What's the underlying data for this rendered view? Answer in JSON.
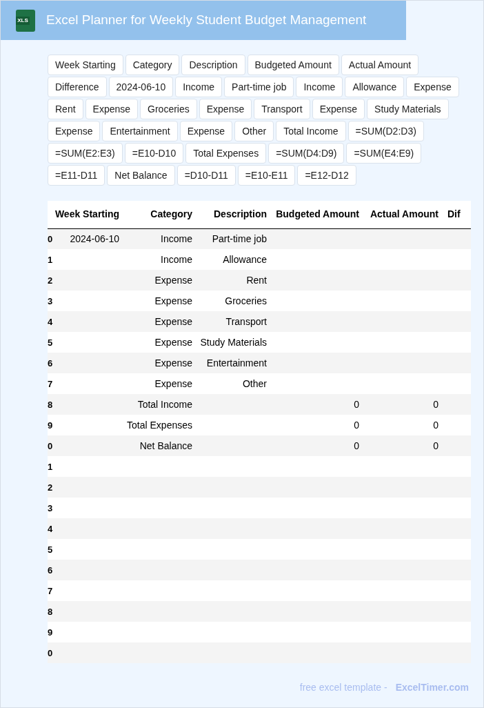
{
  "header": {
    "icon_label": "XLS",
    "title": "Excel Planner for Weekly Student Budget Management"
  },
  "chips": [
    "Week Starting",
    "Category",
    "Description",
    "Budgeted Amount",
    "Actual Amount",
    "Difference",
    "2024-06-10",
    "Income",
    "Part-time job",
    "Income",
    "Allowance",
    "Expense",
    "Rent",
    "Expense",
    "Groceries",
    "Expense",
    "Transport",
    "Expense",
    "Study Materials",
    "Expense",
    "Entertainment",
    "Expense",
    "Other",
    "Total Income",
    "=SUM(D2:D3)",
    "=SUM(E2:E3)",
    "=E10-D10",
    "Total Expenses",
    "=SUM(D4:D9)",
    "=SUM(E4:E9)",
    "=E11-D11",
    "Net Balance",
    "=D10-D11",
    "=E10-E11",
    "=E12-D12"
  ],
  "table": {
    "columns": [
      "Week Starting",
      "Category",
      "Description",
      "Budgeted Amount",
      "Actual Amount",
      "Dif"
    ],
    "rows": [
      {
        "index": "0",
        "week_starting": "2024-06-10",
        "category": "Income",
        "description": "Part-time job"
      },
      {
        "index": "1",
        "category": "Income",
        "description": "Allowance"
      },
      {
        "index": "2",
        "category": "Expense",
        "description": "Rent"
      },
      {
        "index": "3",
        "category": "Expense",
        "description": "Groceries"
      },
      {
        "index": "4",
        "category": "Expense",
        "description": "Transport"
      },
      {
        "index": "5",
        "category": "Expense",
        "description": "Study Materials"
      },
      {
        "index": "6",
        "category": "Expense",
        "description": "Entertainment"
      },
      {
        "index": "7",
        "category": "Expense",
        "description": "Other"
      },
      {
        "index": "8",
        "category": "Total Income",
        "budgeted": "0",
        "actual": "0"
      },
      {
        "index": "9",
        "category": "Total Expenses",
        "budgeted": "0",
        "actual": "0"
      },
      {
        "index": "0",
        "category": "Net Balance",
        "budgeted": "0",
        "actual": "0"
      },
      {
        "index": "1"
      },
      {
        "index": "2"
      },
      {
        "index": "3"
      },
      {
        "index": "4"
      },
      {
        "index": "5"
      },
      {
        "index": "6"
      },
      {
        "index": "7"
      },
      {
        "index": "8"
      },
      {
        "index": "9"
      },
      {
        "index": "0"
      }
    ]
  },
  "footer": {
    "text": "free excel template -",
    "link": "ExcelTimer.com"
  }
}
